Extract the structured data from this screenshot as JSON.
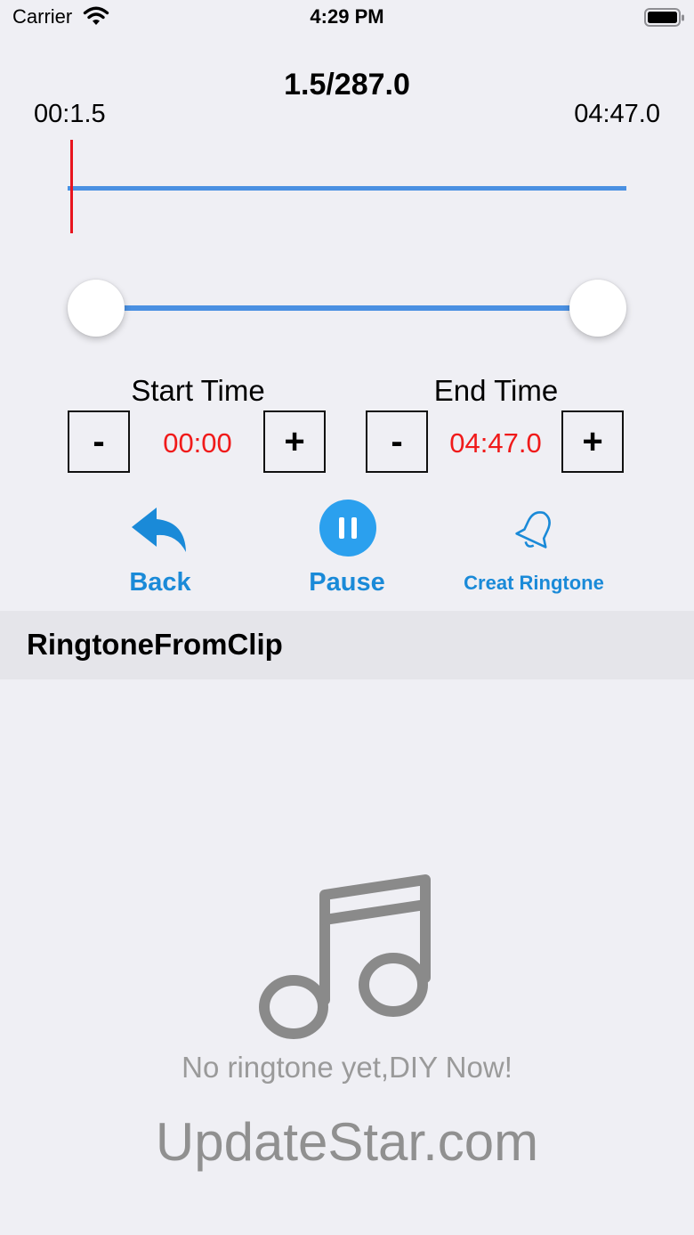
{
  "status_bar": {
    "carrier": "Carrier",
    "time": "4:29 PM",
    "wifi_icon": "wifi-icon",
    "battery_icon": "battery-icon"
  },
  "player": {
    "progress_label": "1.5/287.0",
    "current_time": "00:1.5",
    "total_time": "04:47.0",
    "playhead_position_seconds": 1.5,
    "duration_seconds": 287.0
  },
  "range": {
    "start_seconds": 0,
    "end_seconds": 287.0
  },
  "start_time": {
    "title": "Start Time",
    "value": "00:00",
    "minus_label": "-",
    "plus_label": "+"
  },
  "end_time": {
    "title": "End Time",
    "value": "04:47.0",
    "minus_label": "-",
    "plus_label": "+"
  },
  "actions": {
    "back_label": "Back",
    "pause_label": "Pause",
    "ringtone_label": "Creat Ringtone"
  },
  "section": {
    "title": "RingtoneFromClip"
  },
  "empty_state": {
    "icon": "music-note-icon",
    "message": "No ringtone yet,DIY Now!"
  },
  "watermark": "UpdateStar.com",
  "colors": {
    "accent_blue": "#1a8ad8",
    "track_blue": "#4a90e2",
    "time_red": "#f01a1a",
    "playhead_red": "#e8141e",
    "background": "#efeff4"
  }
}
